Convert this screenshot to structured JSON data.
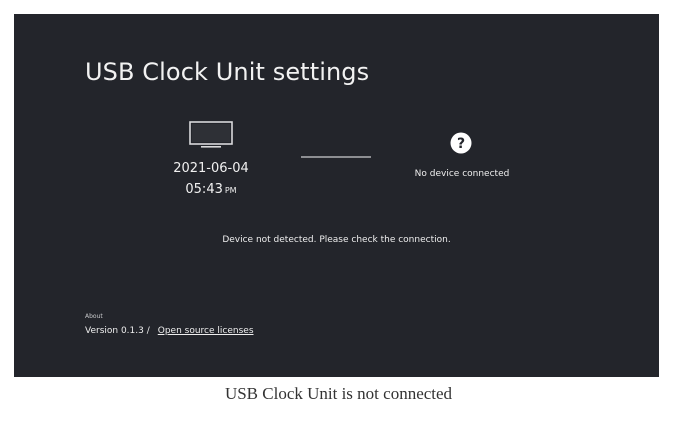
{
  "screen": {
    "title": "USB Clock Unit settings",
    "device_panel": {
      "monitor_icon": "tv-monitor-icon",
      "date": "2021-06-04",
      "time": "05:43",
      "ampm": "PM"
    },
    "usb_panel": {
      "status_icon": "help-question-icon",
      "status_text": "No device connected"
    },
    "message": "Device not detected. Please check the connection.",
    "about": {
      "label": "About",
      "version": "Version 0.1.3 /",
      "licenses_link": "Open source licenses"
    }
  },
  "caption": "USB Clock Unit is not connected",
  "colors": {
    "screen_background": "#23252b",
    "text": "#eeeeee",
    "connector": "#8d8e92",
    "icon_fill": "#ffffff"
  }
}
